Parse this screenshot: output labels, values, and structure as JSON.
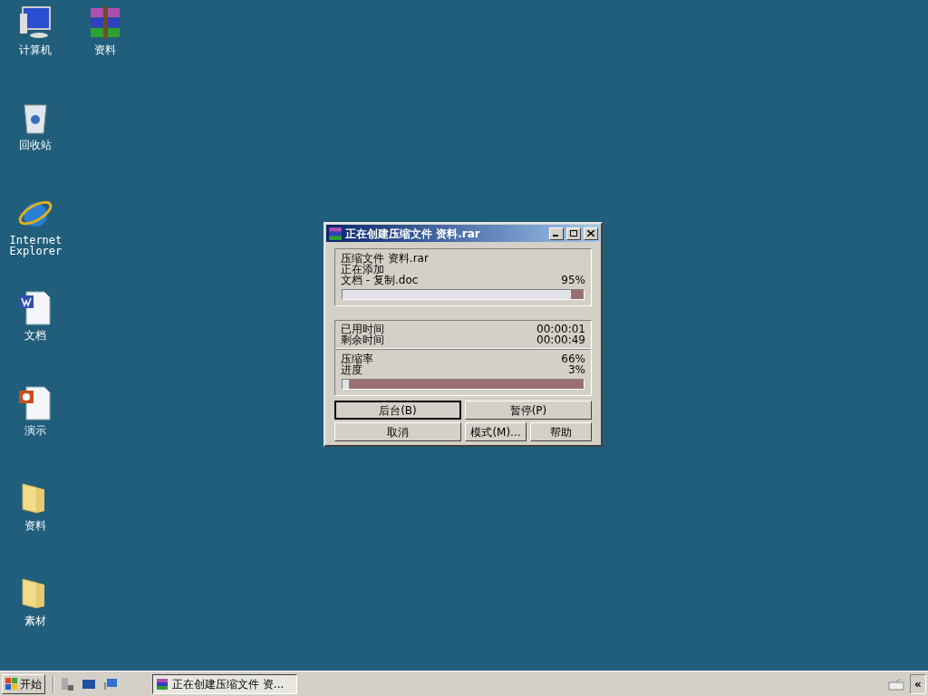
{
  "desktop_rows": [
    [
      {
        "kind": "computer",
        "label": "计算机"
      },
      {
        "kind": "archive",
        "label": "资料"
      }
    ],
    [
      {
        "kind": "recycle",
        "label": "回收站"
      }
    ],
    [
      {
        "kind": "browser",
        "label": "Internet Explorer"
      }
    ],
    [
      {
        "kind": "word",
        "label": "文档"
      }
    ],
    [
      {
        "kind": "slides",
        "label": "演示"
      }
    ],
    [
      {
        "kind": "folder",
        "label": "资料"
      }
    ],
    [
      {
        "kind": "folder",
        "label": "素材"
      }
    ]
  ],
  "window": {
    "title": "正在创建压缩文件 资料.rar",
    "archive_line": "压缩文件 资料.rar",
    "action": "正在添加",
    "file": "文档 - 复制.doc",
    "file_percent": "95%",
    "file_progress": {
      "level": 0.95
    },
    "elapsed_label": "已用时间",
    "elapsed": "00:00:01",
    "remaining_label": "剩余时间",
    "remaining": "00:00:49",
    "ratio_label": "压缩率",
    "ratio": "66%",
    "progress_label": "进度",
    "progress": "3%",
    "total_progress": {
      "level": 0.03
    },
    "buttons": [
      {
        "label": "后台(B)",
        "focused": true
      },
      {
        "label": "暂停(P)",
        "focused": false
      },
      {
        "label": "取消",
        "focused": false
      },
      {
        "label": "模式(M)...",
        "focused": false
      },
      {
        "label": "帮助",
        "focused": false
      }
    ]
  },
  "taskbar": {
    "start": "开始",
    "task": {
      "label": "正在创建压缩文件 资...",
      "selected": true
    },
    "tray_toggle": "«"
  }
}
